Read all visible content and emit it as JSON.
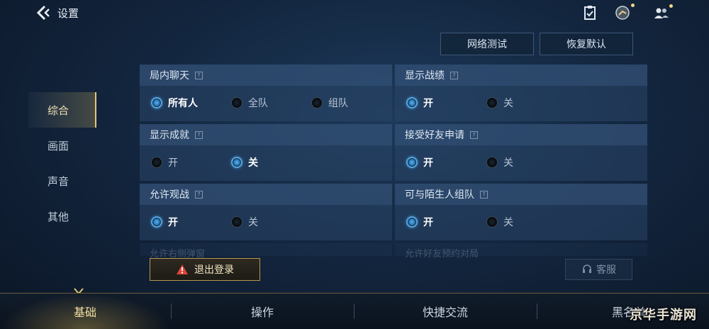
{
  "header": {
    "title": "设置",
    "back_icon": "back-chevron-icon"
  },
  "top_buttons": {
    "network_test": "网络测试",
    "restore_default": "恢复默认"
  },
  "left_nav": [
    "综合",
    "画面",
    "声音",
    "其他"
  ],
  "settings": {
    "chat": {
      "title": "局内聊天",
      "options": [
        "所有人",
        "全队",
        "组队"
      ]
    },
    "show_record": {
      "title": "显示战绩",
      "options": [
        "开",
        "关"
      ]
    },
    "show_achievement": {
      "title": "显示成就",
      "options": [
        "开",
        "关"
      ]
    },
    "accept_friend": {
      "title": "接受好友申请",
      "options": [
        "开",
        "关"
      ]
    },
    "allow_spectate": {
      "title": "允许观战",
      "options": [
        "开",
        "关"
      ]
    },
    "stranger_team": {
      "title": "可与陌生人组队",
      "options": [
        "开",
        "关"
      ]
    }
  },
  "faded_row": {
    "left": "允许右侧弹窗",
    "right": "允许好友预约对局"
  },
  "logout_label": "退出登录",
  "service_label": "客服",
  "bottom_tabs": [
    "基础",
    "操作",
    "快捷交流",
    "黑名单"
  ],
  "watermark": "京华手游网",
  "help_glyph": "?",
  "colors": {
    "accent_gold": "#e4c675",
    "selected_radio": "#5aa4dc",
    "logout_border": "#b9974f"
  }
}
